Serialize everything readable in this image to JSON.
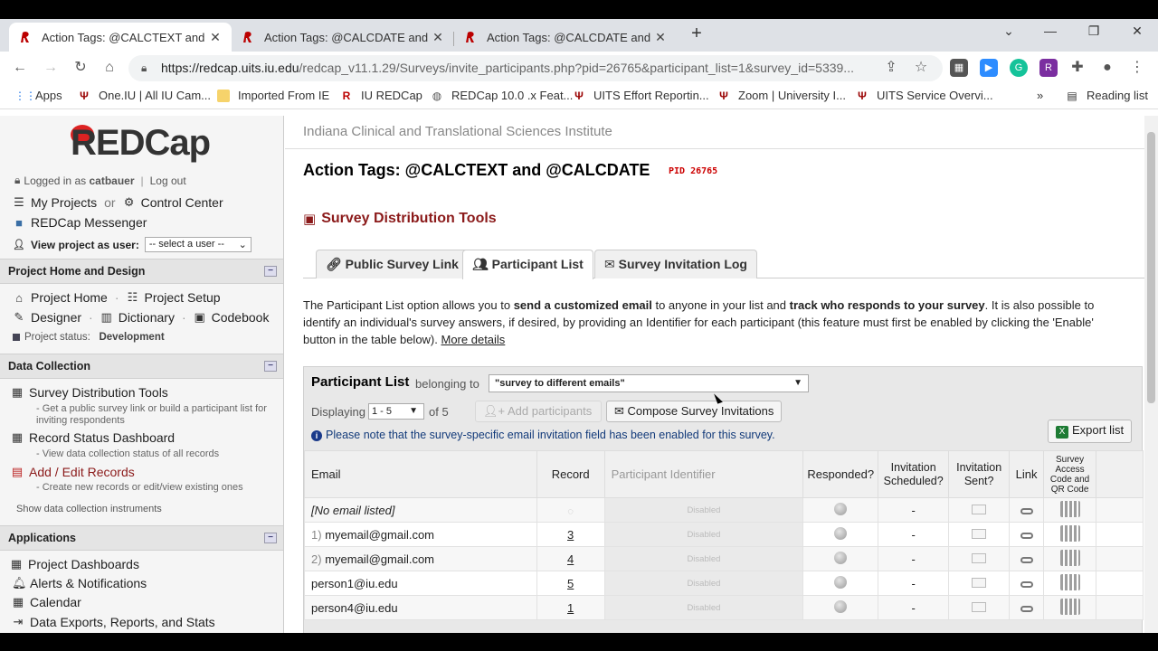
{
  "browser": {
    "tabs": [
      {
        "title": "Action Tags: @CALCTEXT and @CALCDATE",
        "active": true
      },
      {
        "title": "Action Tags: @CALCDATE and @CALCDATE",
        "active": false
      },
      {
        "title": "Action Tags: @CALCDATE and @CALCDATE",
        "active": false
      }
    ],
    "url_host": "https://redcap.uits.iu.edu",
    "url_path": "/redcap_v11.1.29/Surveys/invite_participants.php?pid=26765&participant_list=1&survey_id=5339...",
    "bookmarks": [
      {
        "label": "Apps",
        "icon": "apps-grid-icon"
      },
      {
        "label": "One.IU | All IU Cam...",
        "icon": "iu-trident-icon"
      },
      {
        "label": "Imported From IE",
        "icon": "folder-icon"
      },
      {
        "label": "IU REDCap",
        "icon": "redcap-icon"
      },
      {
        "label": "REDCap 10.0 .x Feat...",
        "icon": "globe-icon"
      },
      {
        "label": "UITS Effort Reportin...",
        "icon": "iu-trident-icon"
      },
      {
        "label": "Zoom | University I...",
        "icon": "iu-trident-icon"
      },
      {
        "label": "UITS Service Overvi...",
        "icon": "iu-trident-icon"
      }
    ],
    "bookmarks_more": "»",
    "reading_list": "Reading list"
  },
  "sidebar": {
    "logo": "REDCap",
    "logged_in_prefix": "Logged in as",
    "username": "catbauer",
    "divider": "|",
    "logout": "Log out",
    "my_projects": "My Projects",
    "or": "or",
    "control_center": "Control Center",
    "messenger": "REDCap Messenger",
    "view_as_label": "View project as user:",
    "view_as_select": "-- select a user --",
    "sections": {
      "home_design": "Project Home and Design",
      "data_collection": "Data Collection",
      "applications": "Applications"
    },
    "collapse_symbol": "−",
    "project_home": "Project Home",
    "project_setup": "Project Setup",
    "designer": "Designer",
    "dictionary": "Dictionary",
    "codebook": "Codebook",
    "status_label": "Project status:",
    "status_value": "Development",
    "survey_tools": "Survey Distribution Tools",
    "survey_tools_desc1": "- Get a public survey link or build a participant list for",
    "survey_tools_desc2": "inviting respondents",
    "record_status": "Record Status Dashboard",
    "record_status_desc": "- View data collection status of all records",
    "add_edit": "Add / Edit Records",
    "add_edit_desc": "- Create new records or edit/view existing ones",
    "show_instruments": "Show data collection instruments",
    "apps": [
      "Project Dashboards",
      "Alerts & Notifications",
      "Calendar",
      "Data Exports, Reports, and Stats"
    ]
  },
  "main": {
    "institute": "Indiana Clinical and Translational Sciences Institute",
    "project_title": "Action Tags: @CALCTEXT and @CALCDATE",
    "pid": "PID 26765",
    "section_title": "Survey Distribution Tools",
    "tabs": [
      "Public Survey Link",
      "Participant List",
      "Survey Invitation Log"
    ],
    "desc_1": "The Participant List option allows you to ",
    "desc_b1": "send a customized email",
    "desc_2": " to anyone in your list and ",
    "desc_b2": "track who responds to your survey",
    "desc_3": ". It is also possible to identify an individual's survey answers, if desired, by providing an Identifier for each participant (this feature must first be enabled by clicking the 'Enable' button in the table below). ",
    "more_details": "More details",
    "plist": {
      "title": "Participant List",
      "belonging": "belonging to",
      "survey_select": "\"survey to different emails\"",
      "displaying": "Displaying",
      "range": "1 - 5",
      "of": "of 5",
      "add_participants": "Add participants",
      "compose": "Compose Survey Invitations",
      "export": "Export list",
      "note": "Please note that the survey-specific email invitation field has been enabled for this survey.",
      "headers": {
        "email": "Email",
        "record": "Record",
        "identifier": "Participant Identifier",
        "responded": "Responded?",
        "scheduled": "Invitation Scheduled?",
        "sent": "Invitation Sent?",
        "link": "Link",
        "qr": "Survey Access Code and QR Code"
      },
      "rows": [
        {
          "num": "",
          "email": "[No email listed]",
          "record": "",
          "identifier": "Disabled",
          "scheduled": "-"
        },
        {
          "num": "1)",
          "email": "myemail@gmail.com",
          "record": "3",
          "identifier": "Disabled",
          "scheduled": "-"
        },
        {
          "num": "2)",
          "email": "myemail@gmail.com",
          "record": "4",
          "identifier": "Disabled",
          "scheduled": "-"
        },
        {
          "num": "",
          "email": "person1@iu.edu",
          "record": "5",
          "identifier": "Disabled",
          "scheduled": "-"
        },
        {
          "num": "",
          "email": "person4@iu.edu",
          "record": "1",
          "identifier": "Disabled",
          "scheduled": "-"
        }
      ]
    }
  }
}
